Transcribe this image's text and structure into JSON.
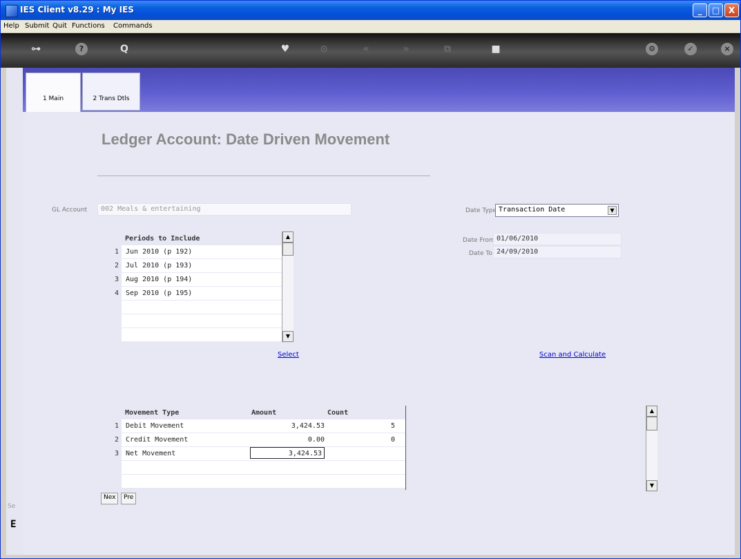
{
  "window": {
    "title": "IES Client v8.29 : My IES",
    "buttons": {
      "min": "_",
      "max": "□",
      "close": "X"
    }
  },
  "menu": [
    "Help",
    "Submit",
    "Quit",
    "Functions",
    "Commands"
  ],
  "toolbar": {
    "icons": [
      {
        "name": "key-icon",
        "glyph": "⊶"
      },
      {
        "name": "help-icon",
        "glyph": "?"
      },
      {
        "name": "search-icon",
        "glyph": "Q"
      },
      {
        "name": "heart-icon",
        "glyph": "♥"
      },
      {
        "name": "clock-icon",
        "glyph": "⊙"
      },
      {
        "name": "rewind-icon",
        "glyph": "«"
      },
      {
        "name": "fast-forward-icon",
        "glyph": "»"
      },
      {
        "name": "copy-icon",
        "glyph": "⧉"
      },
      {
        "name": "stop-icon",
        "glyph": "■"
      },
      {
        "name": "settings-icon",
        "glyph": "⚙"
      },
      {
        "name": "check-icon",
        "glyph": "✓"
      },
      {
        "name": "close-icon",
        "glyph": "×"
      }
    ]
  },
  "tabs": [
    {
      "label": "1 Main"
    },
    {
      "label": "2 Trans Dtls"
    }
  ],
  "page": {
    "title": "Ledger Account: Date Driven Movement"
  },
  "gl_account": {
    "label": "GL Account",
    "value": "002 Meals & entertaining"
  },
  "date_type": {
    "label": "Date Type",
    "value": "Transaction Date"
  },
  "date_from": {
    "label": "Date From",
    "value": "01/06/2010"
  },
  "date_to": {
    "label": "Date To",
    "value": "24/09/2010"
  },
  "periods": {
    "header": "Periods to Include",
    "rows": [
      {
        "num": "1",
        "text": "Jun 2010 (p 192)"
      },
      {
        "num": "2",
        "text": "Jul 2010 (p 193)"
      },
      {
        "num": "3",
        "text": "Aug 2010 (p 194)"
      },
      {
        "num": "4",
        "text": "Sep 2010 (p 195)"
      }
    ]
  },
  "links": {
    "select": "Select",
    "scan": "Scan and Calculate"
  },
  "movement": {
    "headers": {
      "type": "Movement Type",
      "amount": "Amount",
      "count": "Count"
    },
    "rows": [
      {
        "num": "1",
        "type": "Debit Movement",
        "amount": "3,424.53",
        "count": "5"
      },
      {
        "num": "2",
        "type": "Credit Movement",
        "amount": "0.00",
        "count": "0"
      },
      {
        "num": "3",
        "type": "Net Movement",
        "amount": "3,424.53",
        "count": ""
      }
    ]
  },
  "buttons": {
    "next": "Nex",
    "prev": "Pre"
  },
  "side": {
    "text": "Se",
    "mark": "E"
  },
  "scroll": {
    "up": "▲",
    "down": "▼"
  }
}
